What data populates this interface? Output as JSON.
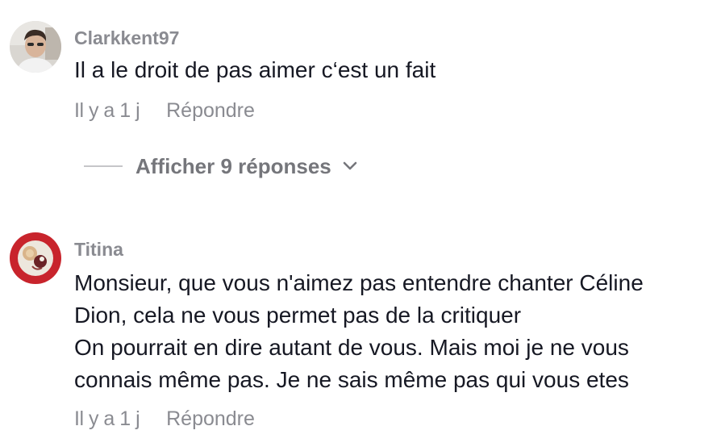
{
  "comments": [
    {
      "username": "Clarkkent97",
      "lines": [
        "Il a le droit de pas aimer c‘est un fait"
      ],
      "time": "Il y a 1 j",
      "reply_label": "Répondre",
      "avatar_icon": "user-avatar-photo"
    },
    {
      "username": "Titina",
      "lines": [
        "Monsieur, que vous n'aimez pas entendre chanter Céline",
        "Dion, cela ne vous permet pas de la critiquer",
        "On pourrait en dire autant de vous. Mais moi je ne vous",
        "connais même pas. Je ne sais même pas qui vous etes"
      ],
      "time": "Il y a 1 j",
      "reply_label": "Répondre",
      "avatar_icon": "user-avatar-photo"
    }
  ],
  "view_replies": {
    "label": "Afficher 9 réponses",
    "icon": "chevron-down-icon"
  },
  "colors": {
    "text": "#161823",
    "secondary": "#8a8b91",
    "replies": "#75767b"
  }
}
